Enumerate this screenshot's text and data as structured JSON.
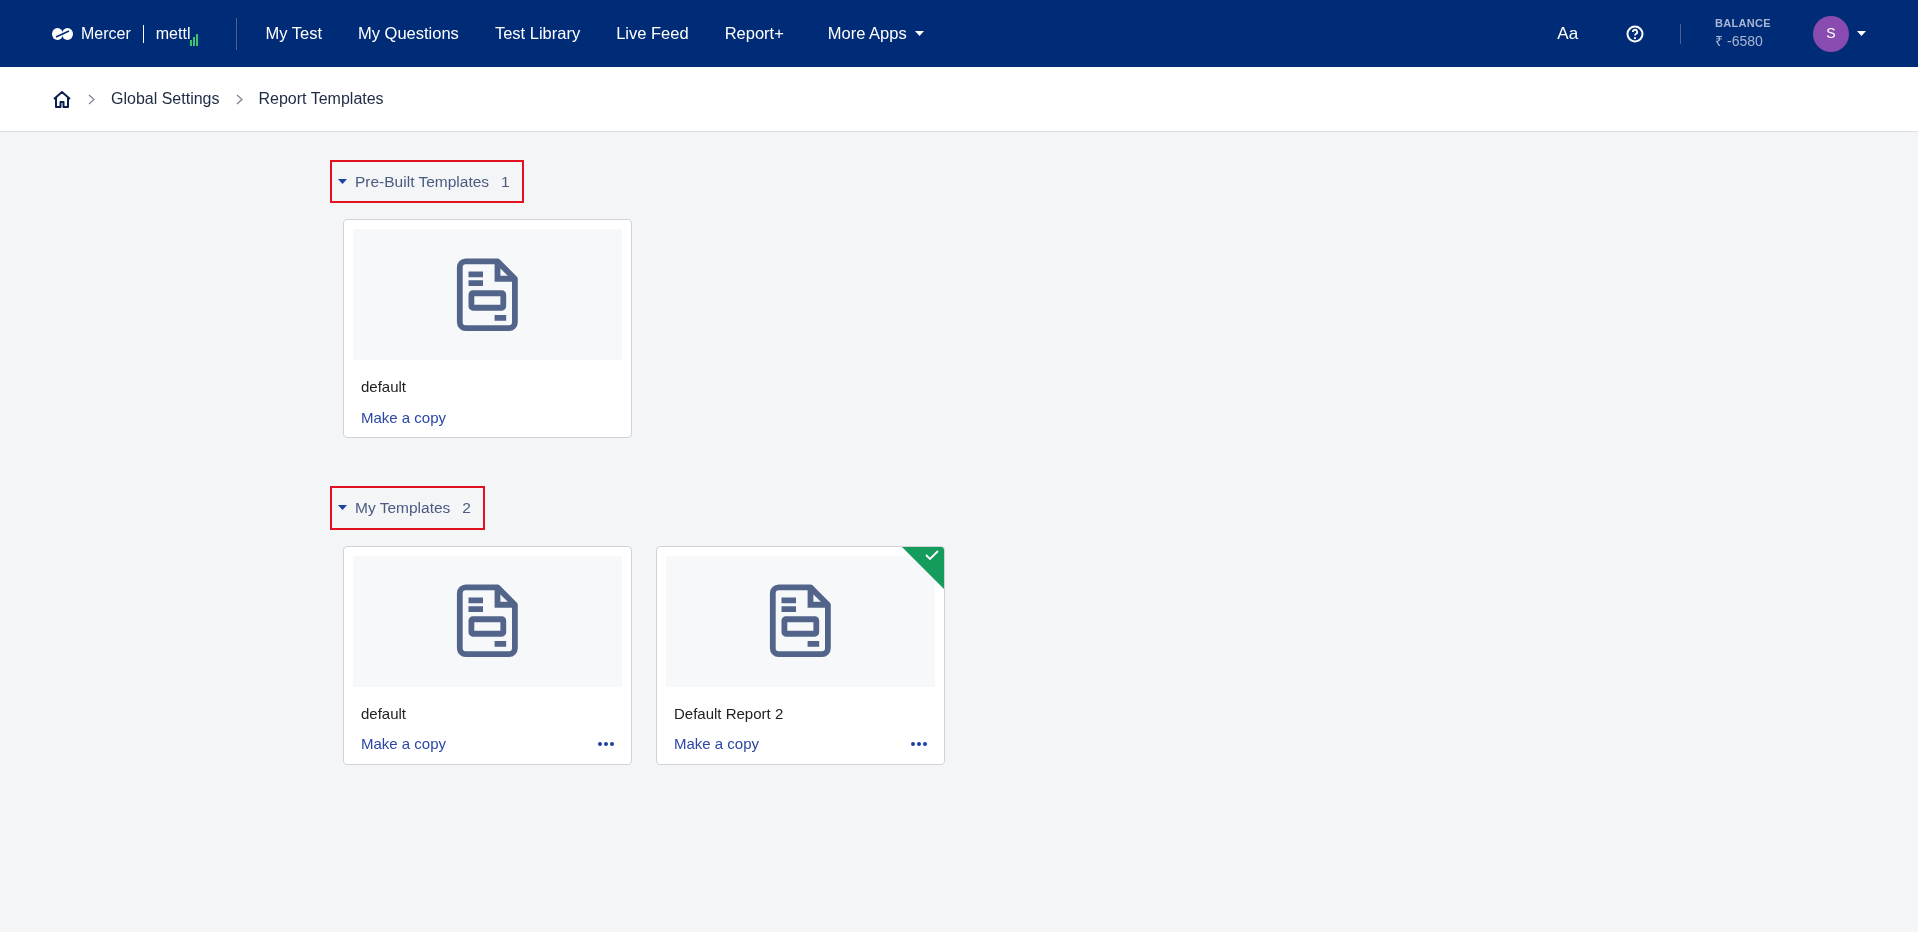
{
  "navbar": {
    "brand": {
      "mercer": "Mercer",
      "mettl": "mettl"
    },
    "items": [
      {
        "label": "My Test",
        "dropdown": false
      },
      {
        "label": "My Questions",
        "dropdown": false
      },
      {
        "label": "Test Library",
        "dropdown": false
      },
      {
        "label": "Live Feed",
        "dropdown": false
      },
      {
        "label": "Report+",
        "dropdown": false
      },
      {
        "label": "More Apps",
        "dropdown": true
      }
    ],
    "font_button": "Aa",
    "balance": {
      "label": "BALANCE",
      "value": "₹ -6580"
    },
    "avatar": {
      "initial": "S"
    }
  },
  "breadcrumb": [
    "Global Settings",
    "Report Templates"
  ],
  "sections": [
    {
      "title": "Pre-Built Templates",
      "count": "1",
      "expanded": true,
      "highlighted": true,
      "cards": [
        {
          "name": "default",
          "action": "Make a copy",
          "has_menu": false,
          "selected": false
        }
      ]
    },
    {
      "title": "My Templates",
      "count": "2",
      "expanded": true,
      "highlighted": true,
      "cards": [
        {
          "name": "default",
          "action": "Make a copy",
          "has_menu": true,
          "selected": false
        },
        {
          "name": "Default Report 2",
          "action": "Make a copy",
          "has_menu": true,
          "selected": true
        }
      ]
    }
  ]
}
